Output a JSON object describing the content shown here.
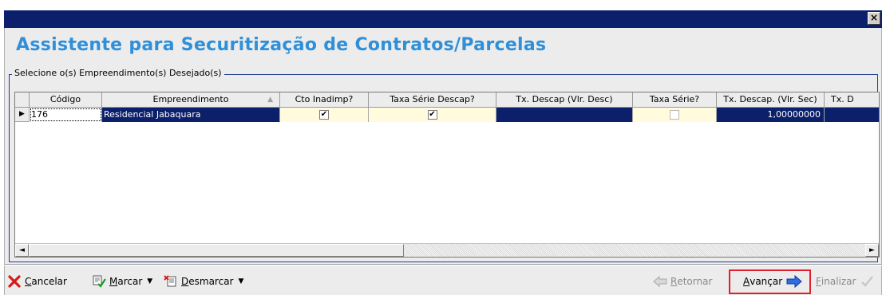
{
  "window": {
    "close_label": "×"
  },
  "heading": "Assistente para Securitização de Contratos/Parcelas",
  "group": {
    "title": "Selecione o(s) Empreendimento(s) Desejado(s)"
  },
  "grid": {
    "columns": [
      {
        "label": "Código"
      },
      {
        "label": "Empreendimento",
        "sorted": true
      },
      {
        "label": "Cto Inadimp?"
      },
      {
        "label": "Taxa Série Descap?"
      },
      {
        "label": "Tx. Descap (Vlr. Desc)"
      },
      {
        "label": "Taxa Série?"
      },
      {
        "label": "Tx. Descap. (Vlr. Sec)"
      },
      {
        "label": "Tx. D"
      }
    ],
    "rows": [
      {
        "codigo": "176",
        "empreendimento": "Residencial Jabaquara",
        "cto_inadimp": true,
        "taxa_serie_descap": true,
        "tx_descap_vlr_desc": "",
        "taxa_serie": false,
        "tx_descap_vlr_sec": "1,00000000",
        "tx_d": ""
      }
    ],
    "scroll_left": "◄",
    "scroll_right": "►"
  },
  "toolbar": {
    "cancel": {
      "prefix": "C",
      "rest": "ancelar"
    },
    "mark": {
      "prefix": "M",
      "rest": "arcar"
    },
    "unmark": {
      "prefix": "D",
      "rest": "esmarcar"
    },
    "back": {
      "prefix": "R",
      "rest": "etornar"
    },
    "next": {
      "prefix": "A",
      "rest": "vançar"
    },
    "finish": {
      "prefix": "F",
      "rest": "inalizar"
    },
    "caret": "▼"
  },
  "colors": {
    "titlebar": "#0b1f6b",
    "heading": "#2f8fd8",
    "selection": "#0b1f6b",
    "highlight_frame": "#e0202a"
  }
}
